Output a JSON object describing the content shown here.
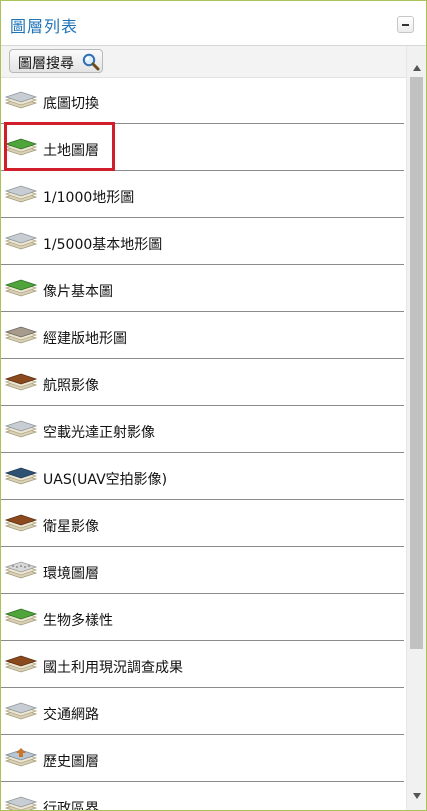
{
  "panel": {
    "title": "圖層列表",
    "collapse_button": "collapse-icon"
  },
  "toolbar": {
    "search_label": "圖層搜尋",
    "search_icon": "magnifier-icon"
  },
  "layers": [
    {
      "label": "底圖切換",
      "icon": "layer-gray-icon"
    },
    {
      "label": "土地圖層",
      "icon": "layer-green-icon",
      "highlighted": true
    },
    {
      "label": "1/1000地形圖",
      "icon": "layer-gray-icon"
    },
    {
      "label": "1/5000基本地形圖",
      "icon": "layer-gray-icon"
    },
    {
      "label": "像片基本圖",
      "icon": "layer-green-icon"
    },
    {
      "label": "經建版地形圖",
      "icon": "layer-stone-icon"
    },
    {
      "label": "航照影像",
      "icon": "layer-brown-icon"
    },
    {
      "label": "空載光達正射影像",
      "icon": "layer-gray-icon"
    },
    {
      "label": "UAS(UAV空拍影像)",
      "icon": "layer-navy-icon"
    },
    {
      "label": "衛星影像",
      "icon": "layer-brown-icon"
    },
    {
      "label": "環境圖層",
      "icon": "layer-dotted-icon"
    },
    {
      "label": "生物多樣性",
      "icon": "layer-green-icon"
    },
    {
      "label": "國土利用現況調查成果",
      "icon": "layer-brown-icon"
    },
    {
      "label": "交通網路",
      "icon": "layer-gray-icon"
    },
    {
      "label": "歷史圖層",
      "icon": "layer-arrow-icon"
    },
    {
      "label": "行政區界",
      "icon": "layer-gray-icon"
    }
  ],
  "colors": {
    "accent": "#1f74b8",
    "panel_border": "#a9c25a",
    "highlight": "#d01f2a"
  }
}
